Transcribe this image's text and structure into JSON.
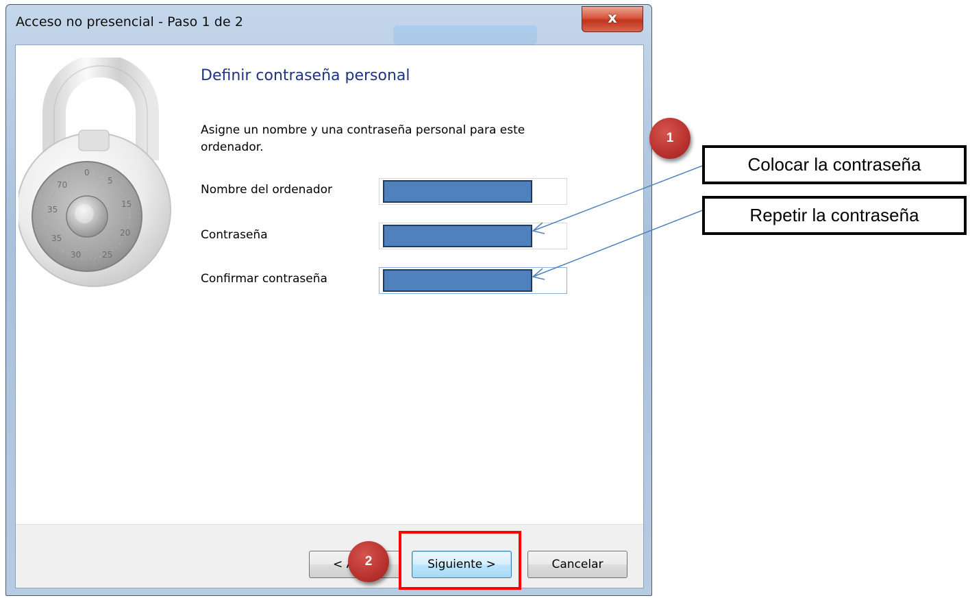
{
  "window": {
    "title": "Acceso no presencial - Paso 1 de 2",
    "close_label": "x"
  },
  "content": {
    "heading": "Definir contraseña personal",
    "description": "Asigne un nombre y una contraseña personal para este ordenador.",
    "fields": [
      {
        "label": "Nombre del ordenador",
        "value": ""
      },
      {
        "label": "Contraseña",
        "value": ""
      },
      {
        "label": "Confirmar contraseña",
        "value": ""
      }
    ]
  },
  "buttons": {
    "back": "< Atrás",
    "next": "Siguiente >",
    "cancel": "Cancelar"
  },
  "annotations": {
    "callout_password": "Colocar la contraseña",
    "callout_repeat": "Repetir la contraseña",
    "badge_1": "1",
    "badge_2": "2",
    "badge_color": "#bb3430",
    "highlight_color": "#ff0000",
    "redaction_color": "#4f81bd"
  },
  "icons": {
    "lock": "combination-padlock-icon",
    "close": "close-icon"
  }
}
